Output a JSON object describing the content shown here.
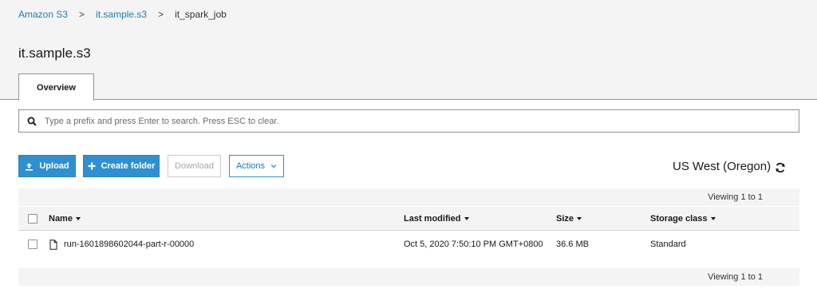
{
  "breadcrumb": {
    "root": "Amazon S3",
    "bucket": "it.sample.s3",
    "current": "it_spark_job",
    "separator": ">"
  },
  "page_title": "it.sample.s3",
  "tabs": [
    {
      "label": "Overview",
      "active": true
    }
  ],
  "search": {
    "placeholder": "Type a prefix and press Enter to search. Press ESC to clear.",
    "value": ""
  },
  "toolbar": {
    "upload_label": "Upload",
    "create_folder_label": "Create folder",
    "download_label": "Download",
    "actions_label": "Actions",
    "region": "US West (Oregon)"
  },
  "pagination": {
    "top": "Viewing 1 to 1",
    "bottom": "Viewing 1 to 1"
  },
  "table": {
    "columns": [
      "Name",
      "Last modified",
      "Size",
      "Storage class"
    ],
    "rows": [
      {
        "name": "run-1601898602044-part-r-00000",
        "last_modified": "Oct 5, 2020 7:50:10 PM GMT+0800",
        "size": "36.6 MB",
        "storage_class": "Standard"
      }
    ]
  },
  "colors": {
    "accent": "#2f90d1",
    "link": "#1f7bb5",
    "band": "#f4f4f4"
  },
  "icons": {
    "search": "search-icon",
    "upload": "upload-icon",
    "create_folder": "plus-icon",
    "actions": "chevron-down-icon",
    "refresh": "refresh-icon",
    "file": "file-icon"
  }
}
